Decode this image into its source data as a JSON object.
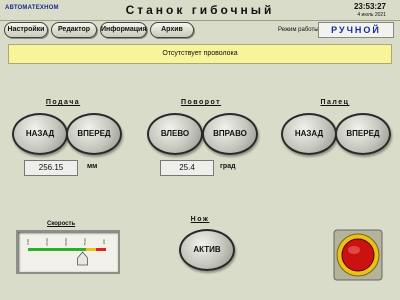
{
  "header": {
    "brand": "АВТОМАТЕХНОМ",
    "title": "Станок гибочный",
    "time": "23:53:27",
    "date": "4 июль 2021"
  },
  "tabs": [
    {
      "label": "Настройки"
    },
    {
      "label": "Редактор"
    },
    {
      "label": "Информация"
    },
    {
      "label": "Архив"
    }
  ],
  "mode": {
    "label": "Режим работы",
    "value": "РУЧНОЙ"
  },
  "status_message": "Отсутствует проволока",
  "feed": {
    "title": "Подача",
    "back_label": "НАЗАД",
    "forward_label": "ВПЕРЕД",
    "value": "256.15",
    "unit": "мм"
  },
  "rotation": {
    "title": "Поворот",
    "left_label": "ВЛЕВО",
    "right_label": "ВПРАВО",
    "value": "25.4",
    "unit": "град"
  },
  "finger": {
    "title": "Палец",
    "back_label": "НАЗАД",
    "forward_label": "ВПЕРЕД"
  },
  "speed": {
    "title": "Скорость",
    "ticks": [
      "0.00",
      "25.00",
      "50.00",
      "75.00",
      "100"
    ],
    "slider_fraction": 0.7
  },
  "knife": {
    "title": "Нож",
    "active_label": "АКТИВ"
  },
  "colors": {
    "background": "#d9dcc9",
    "status_bg": "#f7f49a",
    "mode_text": "#1b2a9a",
    "emergency": "#cc1111"
  },
  "icons": {
    "emergency_stop": "emergency-stop-icon",
    "slider_handle": "slider-handle-icon"
  }
}
